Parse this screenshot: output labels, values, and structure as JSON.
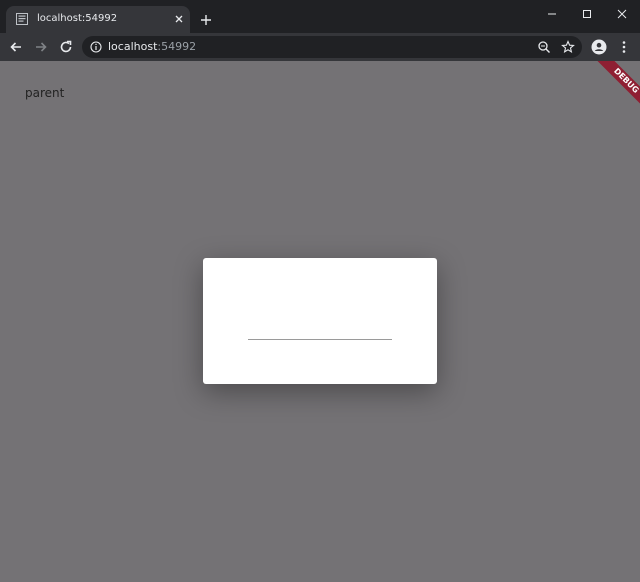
{
  "browser": {
    "tab": {
      "title": "localhost:54992",
      "favicon": "page-icon"
    },
    "new_tab_icon": "plus-icon",
    "window_controls": [
      "minimize-icon",
      "maximize-icon",
      "close-icon"
    ],
    "toolbar": {
      "back_icon": "arrow-left-icon",
      "forward_icon": "arrow-right-icon",
      "reload_icon": "reload-icon",
      "site_info_icon": "info-icon",
      "zoom_icon": "zoom-icon",
      "bookmark_icon": "star-icon",
      "profile_icon": "account-icon",
      "menu_icon": "kebab-menu-icon"
    },
    "address": {
      "host": "localhost",
      "port": ":54992"
    }
  },
  "page": {
    "parent_label": "parent",
    "debug_banner": "DEBUG"
  },
  "colors": {
    "tabstrip": "#202124",
    "toolbar": "#35363a",
    "page_background": "#747275",
    "dialog": "#ffffff",
    "debug_banner": "#8f1f33"
  }
}
